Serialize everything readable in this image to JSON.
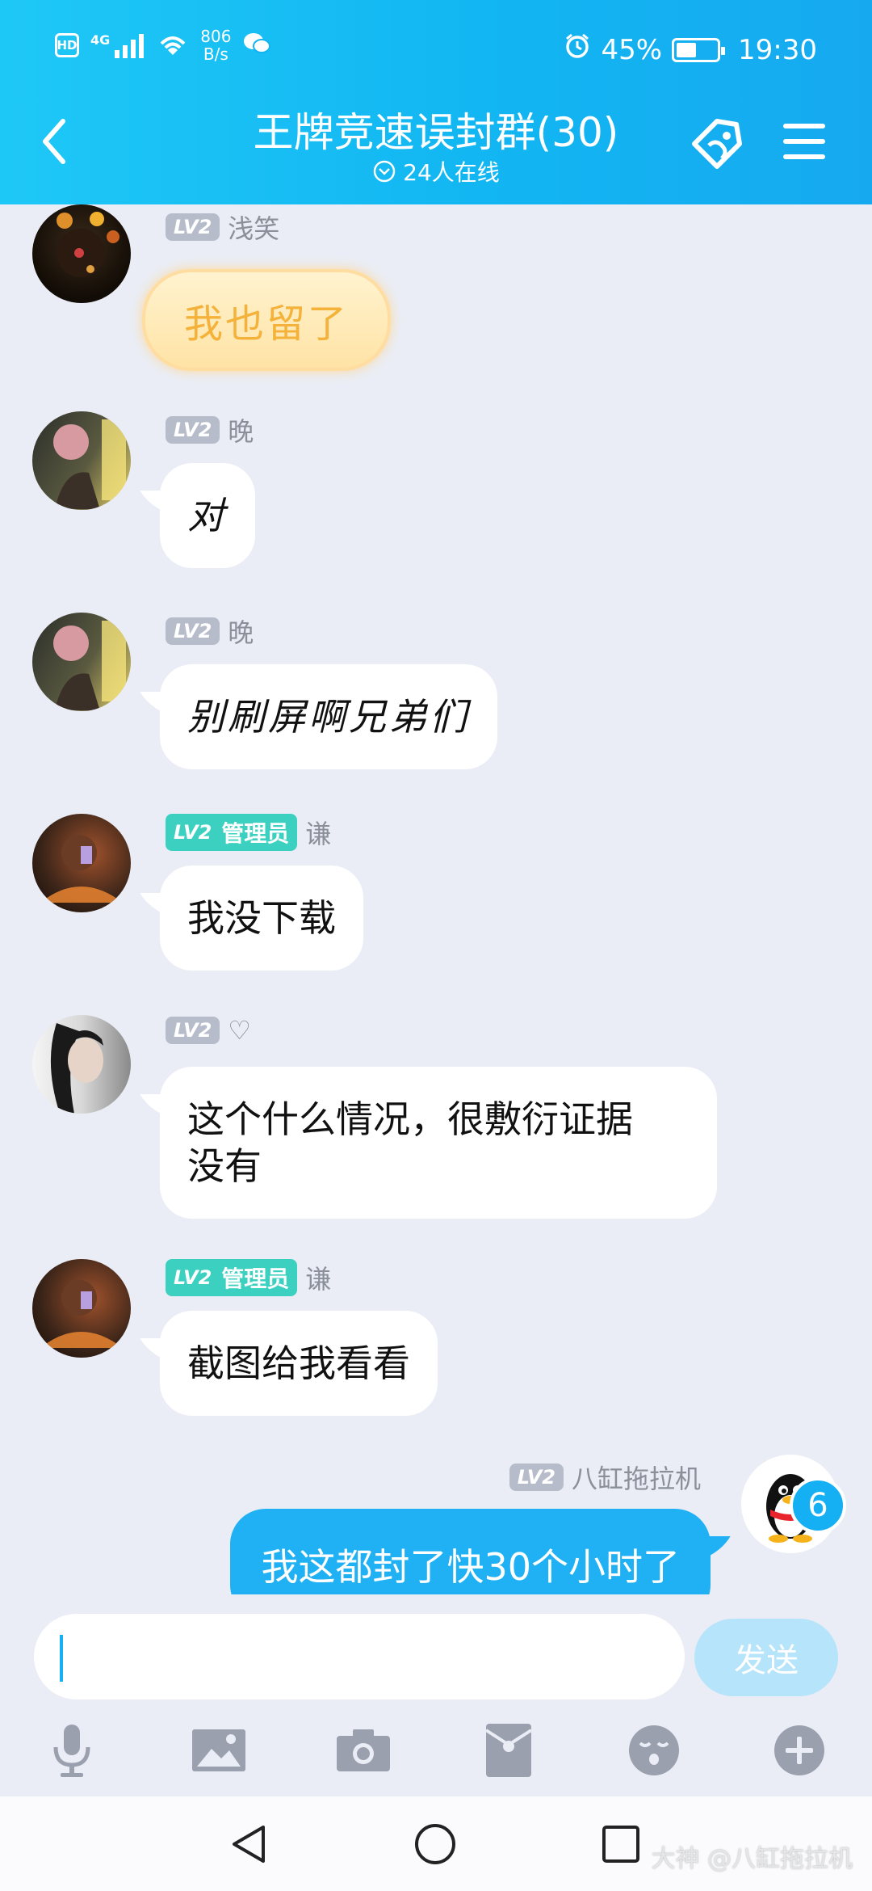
{
  "status_bar": {
    "left_badge": "HD",
    "network": "4G",
    "speed_value": "806",
    "speed_unit": "B/s",
    "battery_pct": "45%",
    "time": "19:30"
  },
  "header": {
    "title": "王牌竞速误封群(30)",
    "online": "24人在线"
  },
  "messages": [
    {
      "level": "LV2",
      "name": "浅笑",
      "text": "我也留了",
      "sticker": true
    },
    {
      "level": "LV2",
      "name": "晚",
      "text": "对"
    },
    {
      "level": "LV2",
      "name": "晚",
      "text": "别刷屏啊兄弟们"
    },
    {
      "level": "LV2",
      "role": "管理员",
      "name": "谦",
      "text": "我没下载"
    },
    {
      "level": "LV2",
      "name": "♡",
      "text": "这个什么情况，很敷衍证据\n没有"
    },
    {
      "level": "LV2",
      "role": "管理员",
      "name": "谦",
      "text": "截图给我看看"
    },
    {
      "level": "LV2",
      "name": "八缸拖拉机",
      "text": "我这都封了快30个小时了",
      "mine": true
    }
  ],
  "unread_count": "6",
  "input": {
    "value": "",
    "send_label": "发送"
  },
  "toolbar": [
    "microphone-icon",
    "image-icon",
    "camera-icon",
    "red-packet-icon",
    "emoji-icon",
    "plus-icon"
  ],
  "watermark": "大神 @八缸拖拉机",
  "colors": {
    "header": "#12b6f2",
    "mine_bubble": "#1fb1f3",
    "admin_badge": "#3bd0c0",
    "background": "#eaedf5"
  }
}
